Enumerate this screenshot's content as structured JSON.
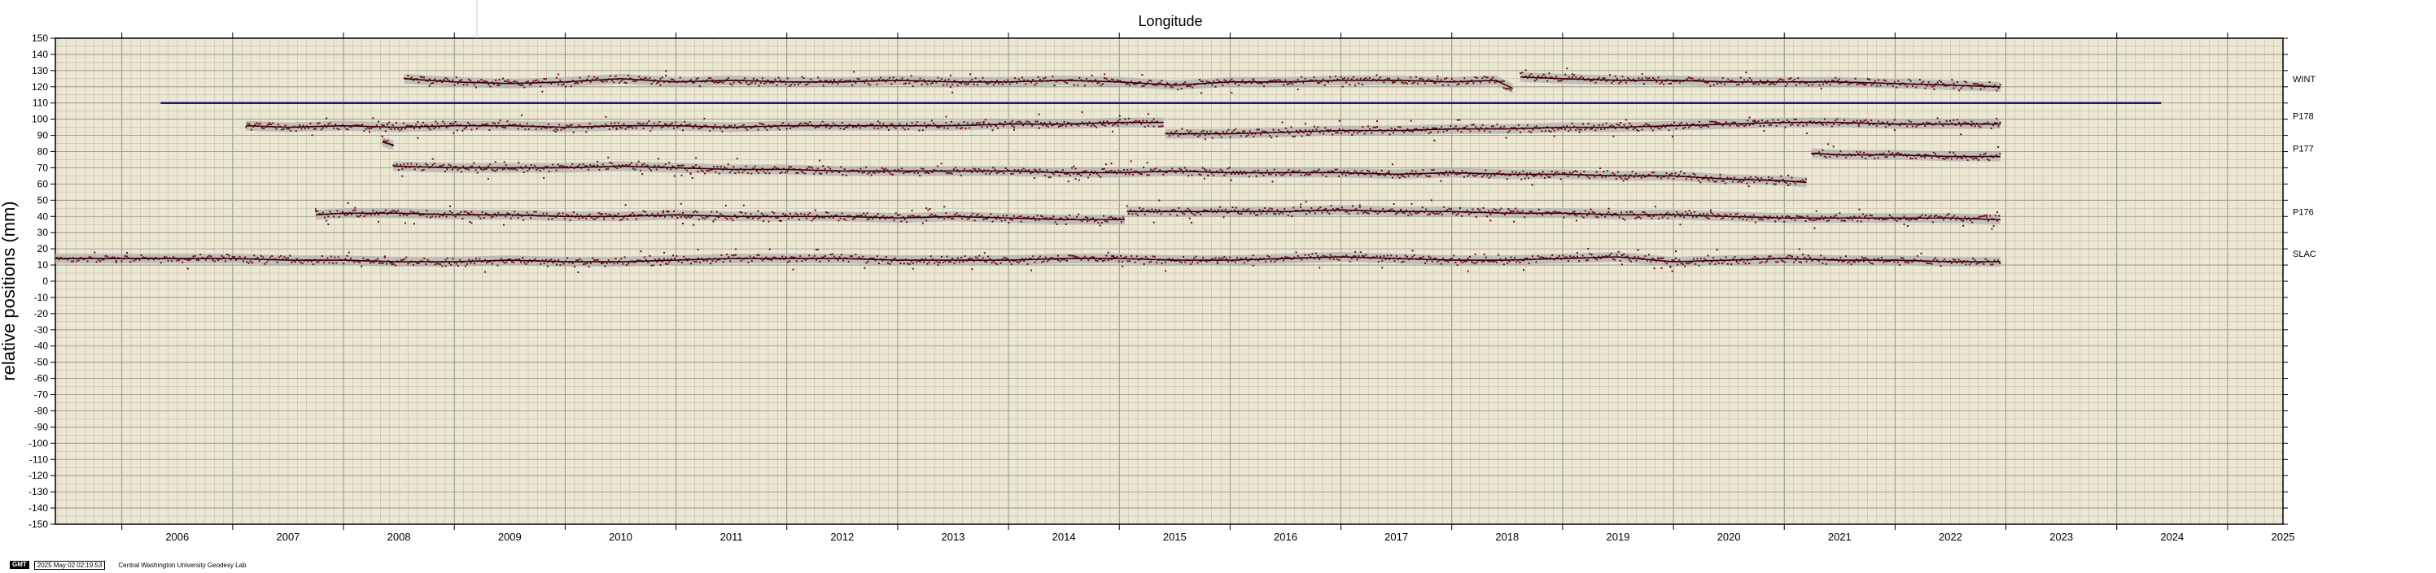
{
  "chart_data": {
    "type": "scatter",
    "title": "Longitude",
    "ylabel": "relative positions (mm)",
    "xlabel": "",
    "xlim": [
      2005.4,
      2025.5
    ],
    "ylim": [
      -150,
      150
    ],
    "y_ticks": [
      150,
      140,
      130,
      120,
      110,
      100,
      90,
      80,
      70,
      60,
      50,
      40,
      30,
      20,
      10,
      0,
      -10,
      -20,
      -30,
      -40,
      -50,
      -60,
      -70,
      -80,
      -90,
      -100,
      -110,
      -120,
      -130,
      -140,
      -150
    ],
    "x_ticks": [
      2006,
      2007,
      2008,
      2009,
      2010,
      2011,
      2012,
      2013,
      2014,
      2015,
      2016,
      2017,
      2018,
      2019,
      2020,
      2021,
      2022,
      2023,
      2024,
      2025
    ],
    "grid": true,
    "reference_line": {
      "y": 110,
      "x": [
        2006.35,
        2024.4
      ],
      "color": "#1a1a6e"
    },
    "series": [
      {
        "name": "WINT",
        "color": "#6b0a0a",
        "uncertainty_color": "#b0b0b0",
        "segments": [
          {
            "x": [
              2008.55,
              2009.0,
              2009.5,
              2010.0,
              2010.5,
              2011.0,
              2011.5,
              2012.0,
              2012.5,
              2013.0,
              2013.5,
              2014.0,
              2014.5,
              2015.0,
              2015.5,
              2016.0,
              2016.5,
              2017.0,
              2017.5,
              2018.0,
              2018.4,
              2018.55
            ],
            "y": [
              125,
              123,
              122,
              123,
              125,
              123,
              124,
              123,
              123,
              124,
              123,
              123,
              124,
              123,
              121,
              123,
              123,
              124,
              124,
              123,
              124,
              119
            ]
          },
          {
            "x": [
              2018.62,
              2019.0,
              2019.5,
              2020.0,
              2020.5,
              2021.0,
              2021.5,
              2022.0,
              2022.5,
              2022.95
            ],
            "y": [
              126,
              125,
              124,
              124,
              123,
              123,
              123,
              122,
              121,
              120
            ]
          }
        ]
      },
      {
        "name": "P178",
        "color": "#6b0a0a",
        "uncertainty_color": "#b0b0b0",
        "segments": [
          {
            "x": [
              2007.12,
              2007.5,
              2008.0,
              2008.5,
              2009.0,
              2009.5,
              2010.0,
              2010.5,
              2011.0,
              2011.5,
              2012.0,
              2012.5,
              2013.0,
              2013.5,
              2014.0,
              2014.5,
              2015.0,
              2015.4
            ],
            "y": [
              96,
              95,
              96,
              95,
              96,
              96,
              95,
              96,
              96,
              95,
              96,
              96,
              96,
              96,
              97,
              97,
              98,
              98
            ]
          },
          {
            "x": [
              2015.42,
              2016.0,
              2016.5,
              2017.0,
              2017.5,
              2018.0,
              2018.5,
              2019.0,
              2019.5,
              2020.0,
              2020.5,
              2021.0,
              2021.5,
              2022.0,
              2022.5,
              2022.95
            ],
            "y": [
              91,
              91,
              92,
              93,
              93,
              94,
              94,
              95,
              95,
              96,
              97,
              98,
              98,
              97,
              97,
              97
            ]
          }
        ]
      },
      {
        "name": "P177",
        "color": "#6b0a0a",
        "uncertainty_color": "#b0b0b0",
        "segments": [
          {
            "x": [
              2008.35,
              2008.45
            ],
            "y": [
              86,
              84
            ]
          },
          {
            "x": [
              2008.45,
              2009.0,
              2009.5,
              2010.0,
              2010.5,
              2011.0,
              2011.5,
              2012.0,
              2012.5,
              2013.0,
              2013.5,
              2014.0,
              2014.5,
              2015.0,
              2015.5,
              2016.0,
              2016.5,
              2017.0,
              2017.5,
              2018.0,
              2018.5,
              2019.0,
              2019.5,
              2020.0,
              2020.5,
              2021.0,
              2021.2
            ],
            "y": [
              71,
              70,
              70,
              70,
              71,
              70,
              69,
              69,
              68,
              68,
              68,
              68,
              67,
              67,
              68,
              67,
              67,
              67,
              66,
              67,
              66,
              66,
              65,
              65,
              63,
              62,
              61
            ]
          },
          {
            "x": [
              2021.25,
              2021.5,
              2022.0,
              2022.5,
              2022.95
            ],
            "y": [
              79,
              78,
              78,
              77,
              77
            ]
          }
        ]
      },
      {
        "name": "P176",
        "color": "#6b0a0a",
        "uncertainty_color": "#b0b0b0",
        "segments": [
          {
            "x": [
              2007.75,
              2008.0,
              2008.5,
              2009.0,
              2009.5,
              2010.0,
              2010.5,
              2011.0,
              2011.5,
              2012.0,
              2012.5,
              2013.0,
              2013.5,
              2014.0,
              2014.5,
              2015.0,
              2015.05
            ],
            "y": [
              41,
              42,
              42,
              41,
              41,
              40,
              40,
              41,
              40,
              40,
              40,
              39,
              40,
              39,
              38,
              38,
              38
            ]
          },
          {
            "x": [
              2015.07,
              2015.5,
              2016.0,
              2016.5,
              2017.0,
              2017.5,
              2018.0,
              2018.5,
              2019.0,
              2019.5,
              2020.0,
              2020.5,
              2021.0,
              2021.5,
              2022.0,
              2022.5,
              2022.95
            ],
            "y": [
              43,
              43,
              43,
              43,
              44,
              43,
              43,
              42,
              42,
              41,
              41,
              40,
              39,
              39,
              39,
              39,
              38
            ]
          }
        ]
      },
      {
        "name": "SLAC",
        "color": "#6b0a0a",
        "uncertainty_color": "#b0b0b0",
        "segments": [
          {
            "x": [
              2005.4,
              2006.0,
              2006.5,
              2007.0,
              2007.5,
              2008.0,
              2008.5,
              2009.0,
              2009.5,
              2010.0,
              2010.5,
              2011.0,
              2011.5,
              2012.0,
              2012.5,
              2013.0,
              2013.5,
              2014.0,
              2014.5,
              2015.0,
              2015.5,
              2016.0,
              2016.5,
              2017.0,
              2017.5,
              2018.0,
              2018.5,
              2019.0,
              2019.5,
              2020.0,
              2020.5,
              2021.0,
              2021.5,
              2022.0,
              2022.5,
              2022.95
            ],
            "y": [
              14,
              14,
              14,
              14,
              13,
              13,
              12,
              12,
              13,
              12,
              12,
              13,
              14,
              14,
              14,
              13,
              13,
              13,
              14,
              14,
              13,
              13,
              14,
              15,
              14,
              13,
              13,
              14,
              15,
              12,
              13,
              14,
              13,
              13,
              12,
              12
            ]
          }
        ]
      }
    ]
  },
  "footer": {
    "logo": "GMT",
    "timestamp": "2025 May 02 02:19:53",
    "credit": "Central Washington University Geodesy Lab"
  }
}
